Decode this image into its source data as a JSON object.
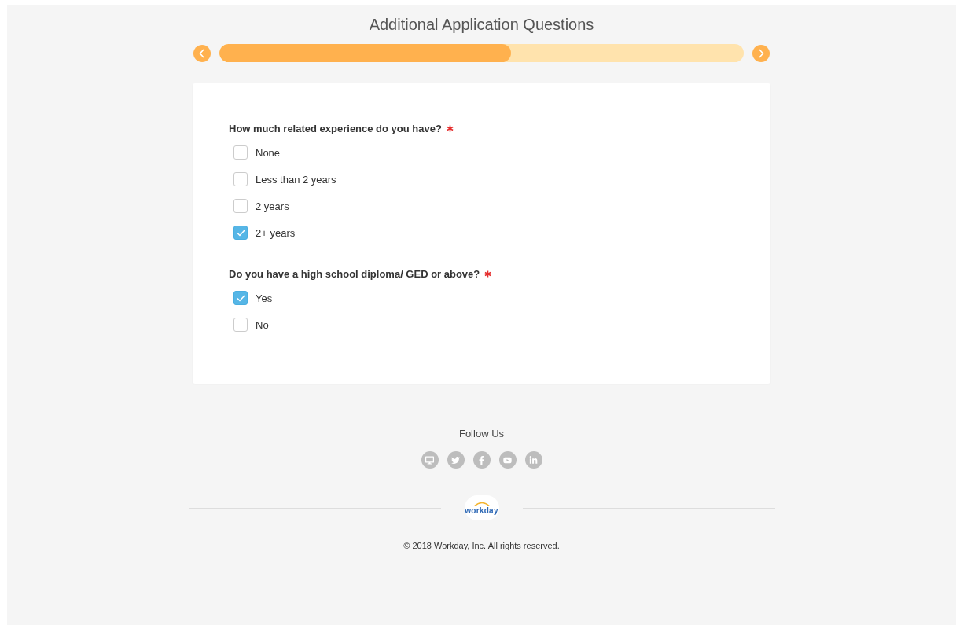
{
  "title": "Additional Application Questions",
  "progress": {
    "level": 0.556
  },
  "questions": [
    {
      "label": "How much related experience do you have?",
      "required": true,
      "options": [
        {
          "label": "None",
          "checked": false
        },
        {
          "label": "Less than 2 years",
          "checked": false
        },
        {
          "label": "2 years",
          "checked": false
        },
        {
          "label": "2+ years",
          "checked": true
        }
      ]
    },
    {
      "label": "Do you have a high school diploma/ GED or above?",
      "required": true,
      "options": [
        {
          "label": "Yes",
          "checked": true
        },
        {
          "label": "No",
          "checked": false
        }
      ]
    }
  ],
  "footer": {
    "follow_label": "Follow Us",
    "social": [
      {
        "kind": "monitor"
      },
      {
        "kind": "twitter"
      },
      {
        "kind": "facebook"
      },
      {
        "kind": "youtube"
      },
      {
        "kind": "linkedin"
      }
    ],
    "logo": "workday",
    "copyright": "© 2018 Workday, Inc. All rights reserved."
  }
}
